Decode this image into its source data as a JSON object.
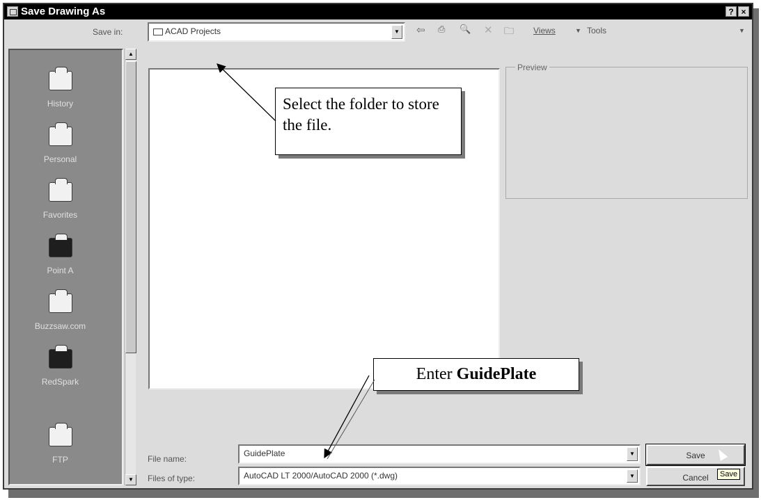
{
  "window": {
    "title": "Save Drawing As",
    "help_btn": "?",
    "close_btn": "×"
  },
  "save_in": {
    "label": "Save in:",
    "value": "ACAD Projects"
  },
  "toolbar": {
    "back": "⇦",
    "up_folder": "⎙",
    "search_web": "🔍",
    "delete": "✕",
    "new_folder": "🗀",
    "views_label": "Views",
    "tools_label": "Tools"
  },
  "places": [
    {
      "label": "History",
      "icon": "history-icon"
    },
    {
      "label": "Personal",
      "icon": "personal-folder-icon"
    },
    {
      "label": "Favorites",
      "icon": "favorites-icon"
    },
    {
      "label": "Point A",
      "icon": "point-a-icon"
    },
    {
      "label": "Buzzsaw.com",
      "icon": "buzzsaw-icon"
    },
    {
      "label": "RedSpark",
      "icon": "redspark-icon"
    },
    {
      "label": "FTP",
      "icon": "ftp-icon"
    }
  ],
  "preview": {
    "label": "Preview"
  },
  "file_name": {
    "label": "File name:",
    "value": "GuidePlate"
  },
  "file_type": {
    "label": "Files of type:",
    "value": "AutoCAD LT 2000/AutoCAD 2000 (*.dwg)"
  },
  "buttons": {
    "save": "Save",
    "cancel": "Cancel"
  },
  "tooltip": "Save",
  "annotations": {
    "callout1": "Select the folder to store the file.",
    "callout2_prefix": "Enter ",
    "callout2_bold": "GuidePlate"
  }
}
